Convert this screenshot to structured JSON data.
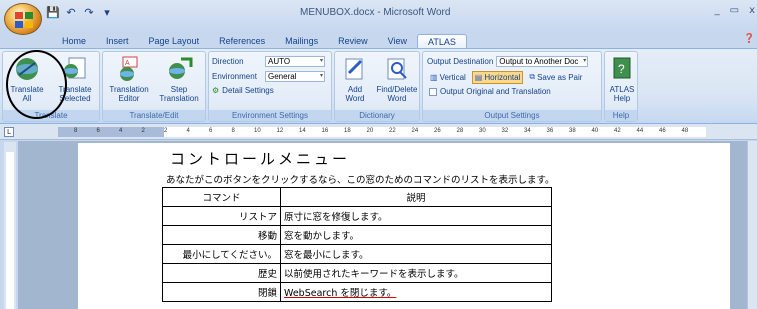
{
  "app": {
    "title": "MENUBOX.docx - Microsoft Word",
    "window_controls": [
      "_",
      "▭",
      "x"
    ]
  },
  "tabs": [
    {
      "label": "Home"
    },
    {
      "label": "Insert"
    },
    {
      "label": "Page Layout"
    },
    {
      "label": "References"
    },
    {
      "label": "Mailings"
    },
    {
      "label": "Review"
    },
    {
      "label": "View"
    },
    {
      "label": "ATLAS"
    }
  ],
  "ribbon": {
    "translate_group": {
      "label": "Translate",
      "translate_all": "Translate\nAll",
      "translate_selected": "Translate\nSelected"
    },
    "translate_edit_group": {
      "label": "Translate/Edit",
      "translation_editor": "Translation\nEditor",
      "step_translation": "Step\nTranslation"
    },
    "environment_group": {
      "label": "Environment Settings",
      "direction_label": "Direction",
      "direction_value": "AUTO",
      "environment_label": "Environment",
      "environment_value": "General",
      "detail_settings": "Detail Settings"
    },
    "dictionary_group": {
      "label": "Dictionary",
      "add_word": "Add\nWord",
      "find_delete_word": "Find/Delete\nWord"
    },
    "output_group": {
      "label": "Output Settings",
      "output_destination_label": "Output Destination",
      "output_destination_value": "Output to Another Doc",
      "vertical": "Vertical",
      "horizontal": "Horizontal",
      "save_as_pair": "Save as Pair",
      "output_original": "Output Original and Translation"
    },
    "help_group": {
      "label": "Help",
      "atlas_help": "ATLAS\nHelp"
    }
  },
  "ruler": {
    "numbers": [
      "8",
      "6",
      "4",
      "2",
      "2",
      "4",
      "6",
      "8",
      "10",
      "12",
      "14",
      "16",
      "18",
      "20",
      "22",
      "24",
      "26",
      "28",
      "30",
      "32",
      "34",
      "36",
      "38",
      "40",
      "42",
      "44",
      "46",
      "48"
    ]
  },
  "document": {
    "title": "コントロールメニュー",
    "intro": "あなたがこのボタンをクリックするなら、この窓のためのコマンドのリストを表示します。",
    "table": {
      "headers": [
        "コマンド",
        "説明"
      ],
      "rows": [
        [
          "リストア",
          "原寸に窓を修復します。"
        ],
        [
          "移動",
          "窓を動かします。"
        ],
        [
          "最小にしてください。",
          "窓を最小にします。"
        ],
        [
          "歴史",
          "以前使用されたキーワードを表示します。"
        ],
        [
          "閉鎖",
          "WebSearch を閉じます。"
        ]
      ]
    }
  }
}
